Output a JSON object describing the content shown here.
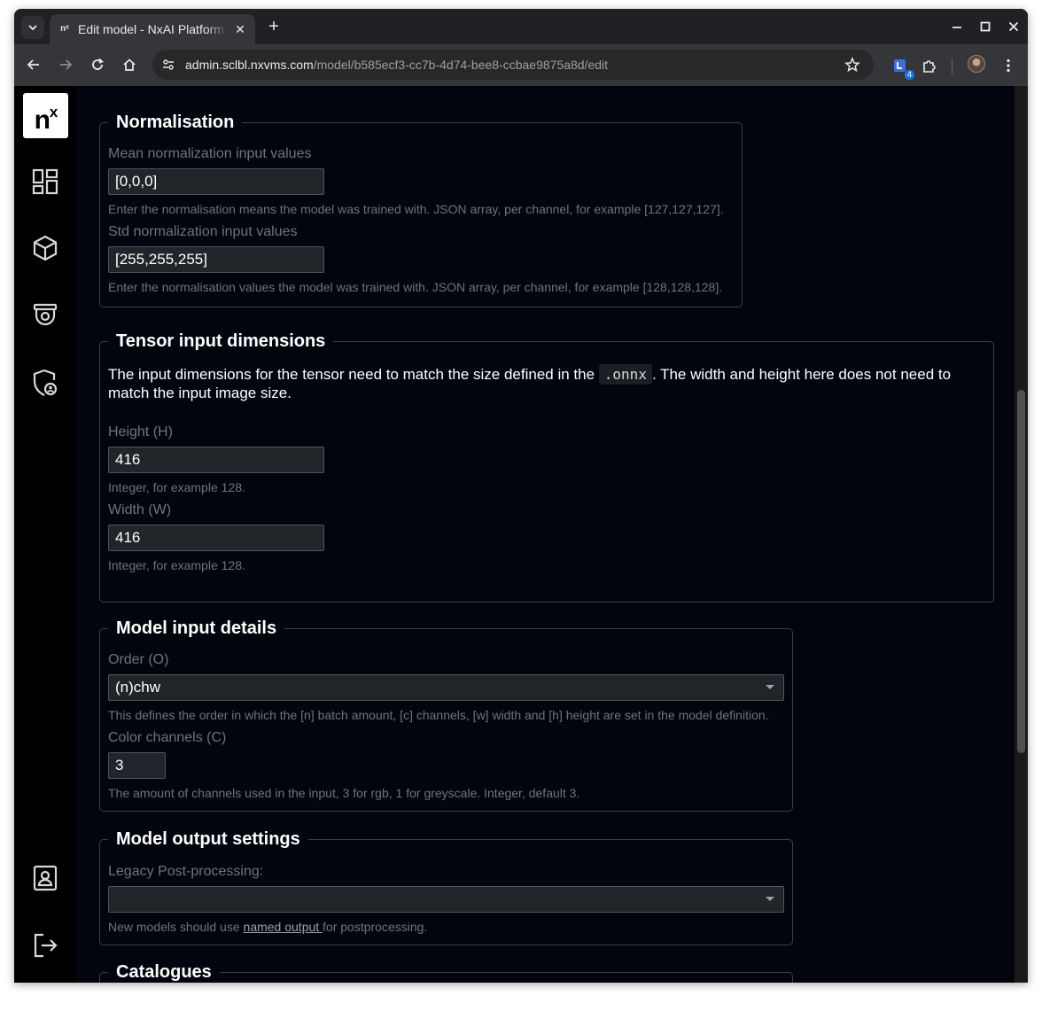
{
  "browser": {
    "tab_title": "Edit model - NxAI Platform",
    "tab_favicon": "nˣ",
    "url_host": "admin.sclbl.nxvms.com",
    "url_path": "/model/b585ecf3-cc7b-4d74-bee8-ccbae9875a8d/edit",
    "extension_badge": "4"
  },
  "sidebar": {
    "logo_text": "n",
    "logo_sup": "x",
    "items": [
      {
        "icon": "dashboard-icon"
      },
      {
        "icon": "cube-icon"
      },
      {
        "icon": "camera-icon"
      },
      {
        "icon": "shield-user-icon"
      },
      {
        "icon": "profile-icon"
      },
      {
        "icon": "logout-icon"
      }
    ]
  },
  "normalisation": {
    "legend": "Normalisation",
    "mean_label": "Mean normalization input values",
    "mean_value": "[0,0,0]",
    "mean_help": "Enter the normalisation means the model was trained with. JSON array, per channel, for example [127,127,127].",
    "std_label": "Std normalization input values",
    "std_value": "[255,255,255]",
    "std_help": "Enter the normalisation values the model was trained with. JSON array, per channel, for example [128,128,128]."
  },
  "tensor": {
    "legend": "Tensor input dimensions",
    "para_before": "The input dimensions for the tensor need to match the size defined in the ",
    "para_code": ".onnx",
    "para_after": ". The width and height here does not need to match the input image size.",
    "height_label": "Height (H)",
    "height_value": "416",
    "height_help": "Integer, for example 128.",
    "width_label": "Width (W)",
    "width_value": "416",
    "width_help": "Integer, for example 128."
  },
  "model_input": {
    "legend": "Model input details",
    "order_label": "Order (O)",
    "order_value": "(n)chw",
    "order_help": "This defines the order in which the [n] batch amount, [c] channels, [w] width and [h] height are set in the model definition.",
    "channels_label": "Color channels (C)",
    "channels_value": "3",
    "channels_help": "The amount of channels used in the input, 3 for rgb, 1 for greyscale. Integer, default 3."
  },
  "model_output": {
    "legend": "Model output settings",
    "legacy_label": "Legacy Post-processing:",
    "legacy_value": "",
    "help_before": "New models should use ",
    "help_link": "named output ",
    "help_after": "for postprocessing."
  },
  "catalogues": {
    "legend": "Catalogues"
  }
}
